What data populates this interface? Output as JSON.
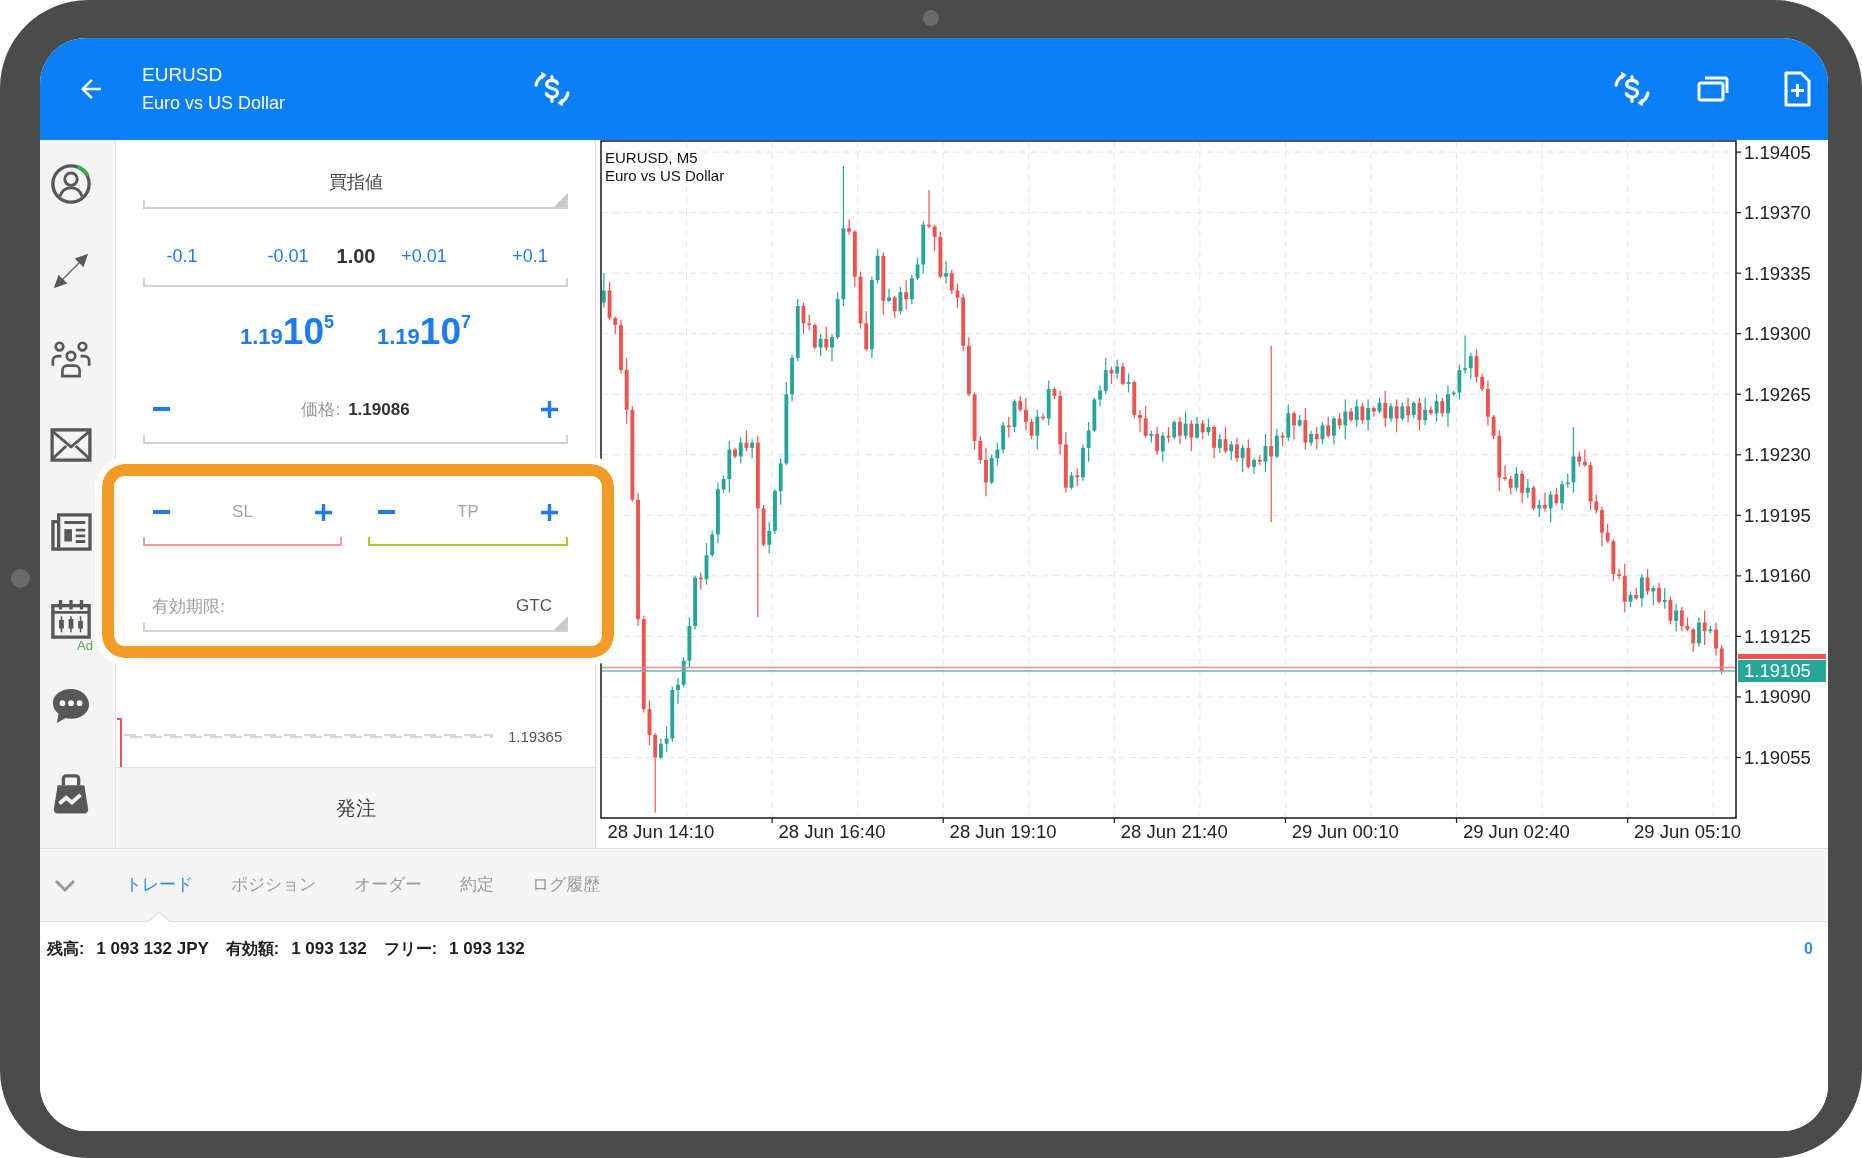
{
  "top_bar": {
    "symbol": "EURUSD",
    "description": "Euro vs US Dollar"
  },
  "sidebar": {
    "calendar_badge": "Ad"
  },
  "order_panel": {
    "order_type": "買指値",
    "volume": {
      "decrease": [
        "-0.1",
        "-0.01"
      ],
      "value": "1.00",
      "increase": [
        "+0.01",
        "+0.1"
      ]
    },
    "quotes": [
      {
        "small": "1.19",
        "large": "10",
        "superscript": "5"
      },
      {
        "small": "1.19",
        "large": "10",
        "superscript": "7"
      }
    ],
    "price": {
      "label": "価格:",
      "value": "1.19086"
    },
    "stops": [
      {
        "placeholder": "SL",
        "color": "#f29b9b"
      },
      {
        "placeholder": "TP",
        "color": "#a8cc2e"
      }
    ],
    "expiration": {
      "label": "有効期限:",
      "value": "GTC"
    },
    "level_line_label": "1.19365",
    "submit": "発注"
  },
  "chart": {
    "symbol_line": "EURUSD, M5",
    "description": "Euro vs US Dollar",
    "current_price": "1.19105",
    "chart_data": {
      "type": "candlestick",
      "grid": true,
      "ylim": [
        1.1902,
        1.194114
      ],
      "ref_lines": [
        {
          "axis": "y",
          "value": 1.19107,
          "color": "#f28b8b"
        },
        {
          "axis": "y",
          "value": 1.19105,
          "color": "#5dbfb3"
        }
      ],
      "yticks": [
        {
          "value": 1.19405,
          "label": "1.19405"
        },
        {
          "value": 1.1937,
          "label": "1.19370"
        },
        {
          "value": 1.19335,
          "label": "1.19335"
        },
        {
          "value": 1.193,
          "label": "1.19300"
        },
        {
          "value": 1.19265,
          "label": "1.19265"
        },
        {
          "value": 1.1923,
          "label": "1.19230"
        },
        {
          "value": 1.19195,
          "label": "1.19195"
        },
        {
          "value": 1.1916,
          "label": "1.19160"
        },
        {
          "value": 1.19125,
          "label": "1.19125"
        },
        {
          "value": 1.1909,
          "label": "1.19090"
        },
        {
          "value": 1.19055,
          "label": "1.19055"
        }
      ],
      "categories": [
        null,
        null,
        null,
        null,
        null,
        null,
        null,
        null,
        null,
        null,
        "28 Jun 14:10",
        null,
        null,
        null,
        null,
        null,
        null,
        null,
        null,
        null,
        null,
        null,
        null,
        null,
        null,
        null,
        null,
        null,
        null,
        null,
        null,
        null,
        null,
        null,
        null,
        null,
        null,
        null,
        null,
        null,
        "28 Jun 16:40",
        null,
        null,
        null,
        null,
        null,
        null,
        null,
        null,
        null,
        null,
        null,
        null,
        null,
        null,
        null,
        null,
        null,
        null,
        null,
        null,
        null,
        null,
        null,
        null,
        null,
        null,
        null,
        null,
        null,
        "28 Jun 19:10",
        null,
        null,
        null,
        null,
        null,
        null,
        null,
        null,
        null,
        null,
        null,
        null,
        null,
        null,
        null,
        null,
        null,
        null,
        null,
        null,
        null,
        null,
        null,
        null,
        null,
        null,
        null,
        null,
        null,
        "28 Jun 21:40",
        null,
        null,
        null,
        null,
        null,
        null,
        null,
        null,
        null,
        null,
        null,
        null,
        null,
        null,
        null,
        null,
        null,
        null,
        null,
        null,
        null,
        null,
        null,
        null,
        null,
        null,
        null,
        null,
        null,
        "29 Jun 00:10",
        null,
        null,
        null,
        null,
        null,
        null,
        null,
        null,
        null,
        null,
        null,
        null,
        null,
        null,
        null,
        null,
        null,
        null,
        null,
        null,
        null,
        null,
        null,
        null,
        null,
        null,
        null,
        null,
        null,
        "29 Jun 02:40",
        null,
        null,
        null,
        null,
        null,
        null,
        null,
        null,
        null,
        null,
        null,
        null,
        null,
        null,
        null,
        null,
        null,
        null,
        null,
        null,
        null,
        null,
        null,
        null,
        null,
        null,
        null,
        null,
        null,
        "29 Jun 05:10",
        null,
        null,
        null,
        null,
        null,
        null,
        null,
        null
      ],
      "ohlc": [
        [
          1.19318,
          1.19335,
          1.19315,
          1.19325
        ],
        [
          1.19325,
          1.1933,
          1.19308,
          1.19309
        ],
        [
          1.19309,
          1.1931,
          1.193,
          1.19305
        ],
        [
          1.19305,
          1.19308,
          1.19277,
          1.19279
        ],
        [
          1.19279,
          1.19286,
          1.19248,
          1.19256
        ],
        [
          1.19256,
          1.19258,
          1.19203,
          1.19204
        ],
        [
          1.19204,
          1.19208,
          1.19131,
          1.19135
        ],
        [
          1.19135,
          1.19137,
          1.19081,
          1.19083
        ],
        [
          1.19083,
          1.19088,
          1.19062,
          1.19068
        ],
        [
          1.19068,
          1.19069,
          1.19023,
          1.19055
        ],
        [
          1.19055,
          1.19066,
          1.19054,
          1.19063
        ],
        [
          1.19063,
          1.19073,
          1.19058,
          1.19066
        ],
        [
          1.19066,
          1.19096,
          1.19064,
          1.19094
        ],
        [
          1.19094,
          1.19101,
          1.19086,
          1.19097
        ],
        [
          1.19097,
          1.19113,
          1.19096,
          1.19111
        ],
        [
          1.19111,
          1.19136,
          1.19107,
          1.19131
        ],
        [
          1.19131,
          1.1916,
          1.19129,
          1.19159
        ],
        [
          1.19159,
          1.19162,
          1.19152,
          1.19158
        ],
        [
          1.19158,
          1.19179,
          1.19155,
          1.19172
        ],
        [
          1.19172,
          1.19186,
          1.19171,
          1.19184
        ],
        [
          1.19184,
          1.19214,
          1.19179,
          1.1921
        ],
        [
          1.1921,
          1.19218,
          1.19208,
          1.19216
        ],
        [
          1.19216,
          1.19238,
          1.19208,
          1.19233
        ],
        [
          1.19233,
          1.19234,
          1.19228,
          1.19229
        ],
        [
          1.19229,
          1.1924,
          1.19225,
          1.19237
        ],
        [
          1.19237,
          1.19244,
          1.19232,
          1.19234
        ],
        [
          1.19234,
          1.19239,
          1.19228,
          1.19237
        ],
        [
          1.19237,
          1.19241,
          1.19136,
          1.19199
        ],
        [
          1.19199,
          1.19201,
          1.19177,
          1.19178
        ],
        [
          1.19178,
          1.19191,
          1.19173,
          1.19186
        ],
        [
          1.19186,
          1.1921,
          1.19184,
          1.19209
        ],
        [
          1.19209,
          1.19228,
          1.19201,
          1.19225
        ],
        [
          1.19225,
          1.19272,
          1.19224,
          1.19265
        ],
        [
          1.19265,
          1.19288,
          1.19261,
          1.19286
        ],
        [
          1.19286,
          1.1932,
          1.19284,
          1.19316
        ],
        [
          1.19316,
          1.19318,
          1.193,
          1.19306
        ],
        [
          1.19306,
          1.19311,
          1.19302,
          1.19305
        ],
        [
          1.19305,
          1.19306,
          1.19291,
          1.19292
        ],
        [
          1.19292,
          1.193,
          1.19287,
          1.19297
        ],
        [
          1.19297,
          1.19304,
          1.1929,
          1.19292
        ],
        [
          1.19292,
          1.193,
          1.19284,
          1.19298
        ],
        [
          1.19298,
          1.19324,
          1.19297,
          1.1932
        ],
        [
          1.1932,
          1.19397,
          1.19316,
          1.19361
        ],
        [
          1.19361,
          1.19366,
          1.19357,
          1.19359
        ],
        [
          1.19359,
          1.1936,
          1.19327,
          1.19333
        ],
        [
          1.19333,
          1.19336,
          1.19303,
          1.19306
        ],
        [
          1.19306,
          1.19313,
          1.1929,
          1.19291
        ],
        [
          1.19291,
          1.19333,
          1.19286,
          1.19331
        ],
        [
          1.19331,
          1.19349,
          1.19329,
          1.19345
        ],
        [
          1.19345,
          1.19347,
          1.19311,
          1.19319
        ],
        [
          1.19319,
          1.19326,
          1.19318,
          1.19321
        ],
        [
          1.19321,
          1.19322,
          1.19309,
          1.19313
        ],
        [
          1.19313,
          1.19327,
          1.19311,
          1.19324
        ],
        [
          1.19324,
          1.19331,
          1.19314,
          1.1932
        ],
        [
          1.1932,
          1.19334,
          1.19317,
          1.19332
        ],
        [
          1.19332,
          1.19344,
          1.19331,
          1.1934
        ],
        [
          1.1934,
          1.19365,
          1.19335,
          1.19363
        ],
        [
          1.19363,
          1.19383,
          1.19361,
          1.19362
        ],
        [
          1.19362,
          1.19363,
          1.19348,
          1.19356
        ],
        [
          1.19356,
          1.19359,
          1.19332,
          1.19333
        ],
        [
          1.19333,
          1.19342,
          1.19329,
          1.19335
        ],
        [
          1.19335,
          1.19337,
          1.19323,
          1.19325
        ],
        [
          1.19325,
          1.19329,
          1.19315,
          1.19321
        ],
        [
          1.19321,
          1.19323,
          1.1929,
          1.19293
        ],
        [
          1.19293,
          1.19298,
          1.19264,
          1.19265
        ],
        [
          1.19265,
          1.19266,
          1.19233,
          1.19238
        ],
        [
          1.19238,
          1.19241,
          1.19225,
          1.19227
        ],
        [
          1.19227,
          1.19234,
          1.19206,
          1.19214
        ],
        [
          1.19214,
          1.1923,
          1.19213,
          1.19228
        ],
        [
          1.19228,
          1.19237,
          1.19224,
          1.19233
        ],
        [
          1.19233,
          1.19249,
          1.19231,
          1.19247
        ],
        [
          1.19247,
          1.19252,
          1.1924,
          1.19246
        ],
        [
          1.19246,
          1.19262,
          1.19243,
          1.19261
        ],
        [
          1.19261,
          1.19264,
          1.19255,
          1.19256
        ],
        [
          1.19256,
          1.19263,
          1.19244,
          1.19249
        ],
        [
          1.19249,
          1.19251,
          1.19239,
          1.19241
        ],
        [
          1.19241,
          1.19256,
          1.19233,
          1.19252
        ],
        [
          1.19252,
          1.19254,
          1.1925,
          1.19251
        ],
        [
          1.19251,
          1.19273,
          1.19247,
          1.19268
        ],
        [
          1.19268,
          1.19269,
          1.19262,
          1.19264
        ],
        [
          1.19264,
          1.19267,
          1.1923,
          1.19236
        ],
        [
          1.19236,
          1.19243,
          1.19208,
          1.19211
        ],
        [
          1.19211,
          1.1922,
          1.1921,
          1.19218
        ],
        [
          1.19218,
          1.19222,
          1.19212,
          1.19217
        ],
        [
          1.19217,
          1.19236,
          1.19215,
          1.19234
        ],
        [
          1.19234,
          1.19249,
          1.19226,
          1.19244
        ],
        [
          1.19244,
          1.19263,
          1.19243,
          1.19262
        ],
        [
          1.19262,
          1.1927,
          1.19258,
          1.19267
        ],
        [
          1.19267,
          1.19286,
          1.19265,
          1.19279
        ],
        [
          1.19279,
          1.19281,
          1.19271,
          1.19277
        ],
        [
          1.19277,
          1.19285,
          1.19274,
          1.19281
        ],
        [
          1.19281,
          1.19283,
          1.1927,
          1.19271
        ],
        [
          1.19271,
          1.19277,
          1.19266,
          1.19272
        ],
        [
          1.19272,
          1.19273,
          1.19251,
          1.19253
        ],
        [
          1.19253,
          1.19256,
          1.19243,
          1.19251
        ],
        [
          1.19251,
          1.19258,
          1.1924,
          1.19241
        ],
        [
          1.19241,
          1.19244,
          1.19237,
          1.19242
        ],
        [
          1.19242,
          1.19246,
          1.1923,
          1.19232
        ],
        [
          1.19232,
          1.19243,
          1.19226,
          1.19241
        ],
        [
          1.19241,
          1.19246,
          1.19237,
          1.1924
        ],
        [
          1.1924,
          1.1925,
          1.19239,
          1.19249
        ],
        [
          1.19249,
          1.19252,
          1.19236,
          1.19241
        ],
        [
          1.19241,
          1.19255,
          1.19239,
          1.19248
        ],
        [
          1.19248,
          1.1925,
          1.19232,
          1.1924
        ],
        [
          1.1924,
          1.19252,
          1.19239,
          1.19248
        ],
        [
          1.19248,
          1.1925,
          1.19239,
          1.19243
        ],
        [
          1.19243,
          1.19251,
          1.19241,
          1.19246
        ],
        [
          1.19246,
          1.19247,
          1.19228,
          1.19234
        ],
        [
          1.19234,
          1.19242,
          1.19231,
          1.19239
        ],
        [
          1.19239,
          1.19246,
          1.19231,
          1.19232
        ],
        [
          1.19232,
          1.19238,
          1.19227,
          1.19236
        ],
        [
          1.19236,
          1.1924,
          1.19226,
          1.19228
        ],
        [
          1.19228,
          1.19236,
          1.1922,
          1.19234
        ],
        [
          1.19234,
          1.19239,
          1.19222,
          1.19223
        ],
        [
          1.19223,
          1.19228,
          1.19219,
          1.19227
        ],
        [
          1.19227,
          1.1923,
          1.19224,
          1.19226
        ],
        [
          1.19226,
          1.19242,
          1.1922,
          1.19235
        ],
        [
          1.19235,
          1.19293,
          1.19191,
          1.19229
        ],
        [
          1.19229,
          1.19245,
          1.19228,
          1.19241
        ],
        [
          1.19241,
          1.19243,
          1.19235,
          1.1924
        ],
        [
          1.1924,
          1.19259,
          1.19238,
          1.19254
        ],
        [
          1.19254,
          1.19255,
          1.19239,
          1.19247
        ],
        [
          1.19247,
          1.19253,
          1.19246,
          1.1925
        ],
        [
          1.1925,
          1.19257,
          1.19233,
          1.19237
        ],
        [
          1.19237,
          1.19244,
          1.19235,
          1.19242
        ],
        [
          1.19242,
          1.19246,
          1.19233,
          1.19239
        ],
        [
          1.19239,
          1.19249,
          1.19236,
          1.19247
        ],
        [
          1.19247,
          1.19252,
          1.1924,
          1.19241
        ],
        [
          1.19241,
          1.19252,
          1.19236,
          1.19251
        ],
        [
          1.19251,
          1.19254,
          1.19245,
          1.19247
        ],
        [
          1.19247,
          1.19262,
          1.19239,
          1.19255
        ],
        [
          1.19255,
          1.19257,
          1.19249,
          1.1925
        ],
        [
          1.1925,
          1.19262,
          1.19246,
          1.19258
        ],
        [
          1.19258,
          1.1926,
          1.19248,
          1.1925
        ],
        [
          1.1925,
          1.19262,
          1.19244,
          1.19257
        ],
        [
          1.19257,
          1.19258,
          1.19252,
          1.19255
        ],
        [
          1.19255,
          1.19263,
          1.19254,
          1.1926
        ],
        [
          1.1926,
          1.19267,
          1.19246,
          1.19251
        ],
        [
          1.19251,
          1.1926,
          1.19249,
          1.19258
        ],
        [
          1.19258,
          1.19262,
          1.19243,
          1.19251
        ],
        [
          1.19251,
          1.1926,
          1.1925,
          1.19258
        ],
        [
          1.19258,
          1.19263,
          1.19249,
          1.19253
        ],
        [
          1.19253,
          1.19261,
          1.19251,
          1.1926
        ],
        [
          1.1926,
          1.19263,
          1.19244,
          1.1925
        ],
        [
          1.1925,
          1.19263,
          1.19247,
          1.19256
        ],
        [
          1.19256,
          1.19258,
          1.19253,
          1.19254
        ],
        [
          1.19254,
          1.19265,
          1.19249,
          1.19261
        ],
        [
          1.19261,
          1.19263,
          1.19252,
          1.19254
        ],
        [
          1.19254,
          1.1927,
          1.19246,
          1.19265
        ],
        [
          1.19265,
          1.19267,
          1.19264,
          1.19266
        ],
        [
          1.19266,
          1.19282,
          1.19262,
          1.19279
        ],
        [
          1.19279,
          1.19299,
          1.19277,
          1.1928
        ],
        [
          1.1928,
          1.19289,
          1.19274,
          1.19287
        ],
        [
          1.19287,
          1.19291,
          1.19272,
          1.19275
        ],
        [
          1.19275,
          1.19277,
          1.19267,
          1.19268
        ],
        [
          1.19268,
          1.19273,
          1.19247,
          1.19252
        ],
        [
          1.19252,
          1.19253,
          1.19239,
          1.19241
        ],
        [
          1.19241,
          1.19244,
          1.19209,
          1.19217
        ],
        [
          1.19217,
          1.19224,
          1.19215,
          1.19216
        ],
        [
          1.19216,
          1.19218,
          1.19207,
          1.19211
        ],
        [
          1.19211,
          1.19223,
          1.19209,
          1.19219
        ],
        [
          1.19219,
          1.19221,
          1.19202,
          1.19208
        ],
        [
          1.19208,
          1.19216,
          1.19205,
          1.19211
        ],
        [
          1.19211,
          1.19212,
          1.19198,
          1.19199
        ],
        [
          1.19199,
          1.19204,
          1.19194,
          1.19201
        ],
        [
          1.19201,
          1.19208,
          1.19197,
          1.19199
        ],
        [
          1.19199,
          1.19209,
          1.19191,
          1.19207
        ],
        [
          1.19207,
          1.19211,
          1.19201,
          1.19202
        ],
        [
          1.19202,
          1.19215,
          1.19198,
          1.19213
        ],
        [
          1.19213,
          1.19219,
          1.19211,
          1.19214
        ],
        [
          1.19214,
          1.19246,
          1.19208,
          1.19229
        ],
        [
          1.19229,
          1.19232,
          1.19223,
          1.19226
        ],
        [
          1.19226,
          1.19233,
          1.19223,
          1.19224
        ],
        [
          1.19224,
          1.19226,
          1.19198,
          1.19203
        ],
        [
          1.19203,
          1.19207,
          1.19196,
          1.19198
        ],
        [
          1.19198,
          1.192,
          1.19177,
          1.19185
        ],
        [
          1.19185,
          1.1919,
          1.19179,
          1.1918
        ],
        [
          1.1918,
          1.19181,
          1.19157,
          1.19161
        ],
        [
          1.19161,
          1.19164,
          1.19158,
          1.1916
        ],
        [
          1.1916,
          1.19167,
          1.19139,
          1.19145
        ],
        [
          1.19145,
          1.19151,
          1.19142,
          1.19149
        ],
        [
          1.19149,
          1.19153,
          1.19146,
          1.19147
        ],
        [
          1.19147,
          1.19161,
          1.19142,
          1.19159
        ],
        [
          1.19159,
          1.19164,
          1.19149,
          1.19151
        ],
        [
          1.19151,
          1.19154,
          1.19143,
          1.19153
        ],
        [
          1.19153,
          1.19156,
          1.19144,
          1.19145
        ],
        [
          1.19145,
          1.19153,
          1.19141,
          1.19146
        ],
        [
          1.19146,
          1.19148,
          1.19132,
          1.19134
        ],
        [
          1.19134,
          1.19144,
          1.19128,
          1.1914
        ],
        [
          1.1914,
          1.19142,
          1.19128,
          1.19131
        ],
        [
          1.19131,
          1.19136,
          1.19128,
          1.19129
        ],
        [
          1.19129,
          1.1913,
          1.19116,
          1.19121
        ],
        [
          1.19121,
          1.19136,
          1.19119,
          1.19133
        ],
        [
          1.19133,
          1.1914,
          1.1912,
          1.19128
        ],
        [
          1.19128,
          1.19131,
          1.19127,
          1.19129
        ],
        [
          1.19129,
          1.19133,
          1.19114,
          1.19118
        ],
        [
          1.19118,
          1.1912,
          1.19103,
          1.19105
        ],
        null,
        null
      ]
    }
  },
  "bottom_panel": {
    "tabs": [
      {
        "label": "トレード",
        "selected": true
      },
      {
        "label": "ポジション",
        "selected": false
      },
      {
        "label": "オーダー",
        "selected": false
      },
      {
        "label": "約定",
        "selected": false
      },
      {
        "label": "ログ履歴",
        "selected": false
      }
    ],
    "account": [
      {
        "label": "残高:",
        "value": "1 093 132 JPY"
      },
      {
        "label": "有効額:",
        "value": "1 093 132"
      },
      {
        "label": "フリー:",
        "value": "1 093 132"
      }
    ],
    "summary_value": "0"
  }
}
